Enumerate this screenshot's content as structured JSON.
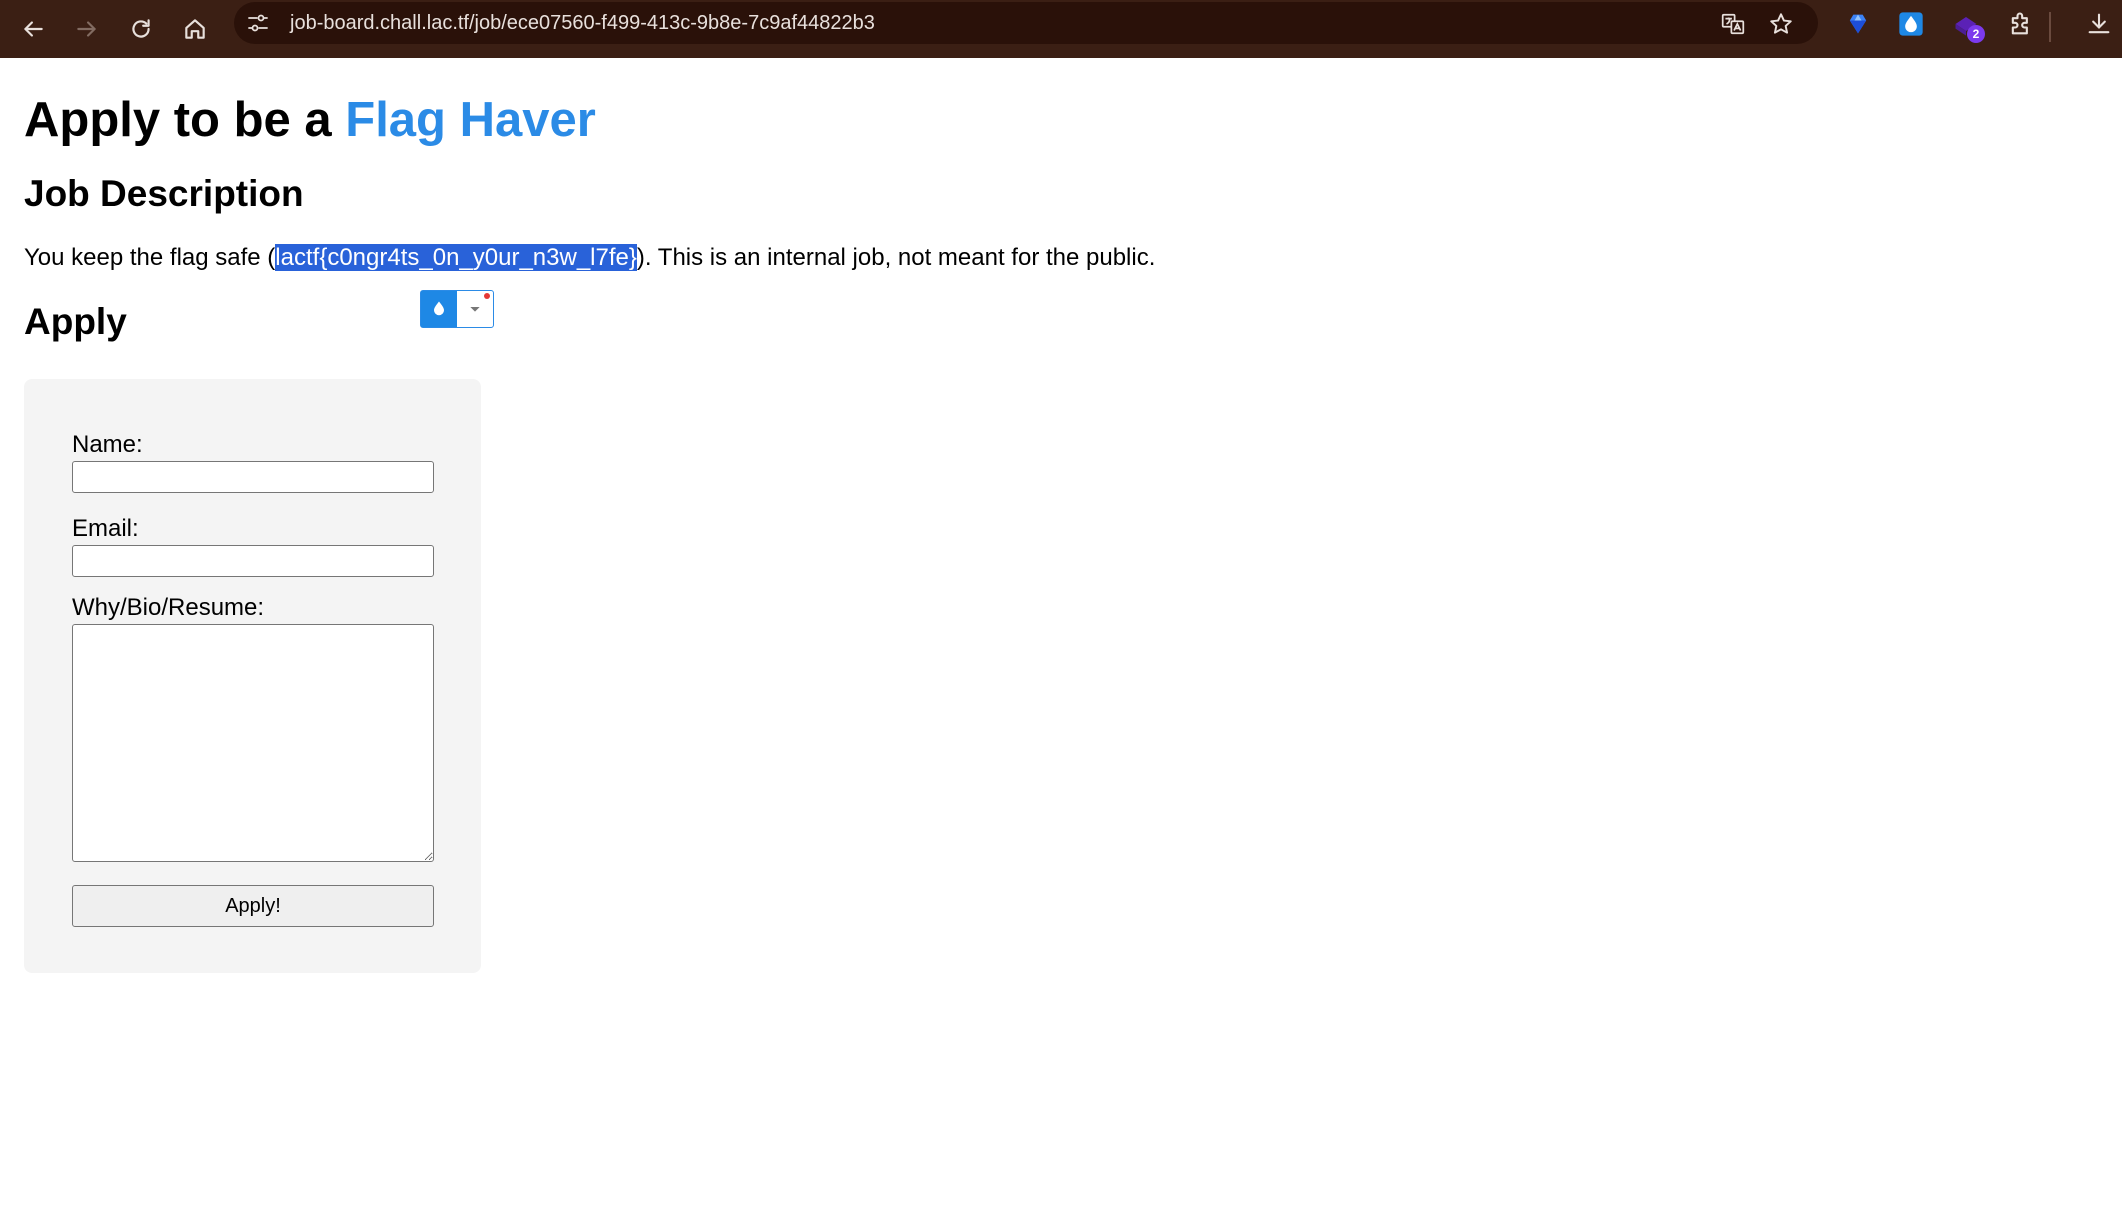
{
  "browser": {
    "url": "job-board.chall.lac.tf/job/ece07560-f499-413c-9b8e-7c9af44822b3",
    "extension_badge": "2",
    "icons": [
      "back-icon",
      "forward-icon",
      "reload-icon",
      "home-icon",
      "site-info-icon",
      "translate-icon",
      "bookmark-star-icon",
      "gem-extension-icon",
      "water-drop-extension-icon",
      "extension-with-badge-icon",
      "extensions-puzzle-icon",
      "download-icon"
    ],
    "colors": {
      "toolbar": "#3b1f14",
      "omnibox": "#2a1109"
    }
  },
  "page": {
    "title_prefix": "Apply to be a ",
    "title_accent": "Flag Haver",
    "accent_color": "#2b8be6",
    "job_description_heading": "Job Description",
    "description_before": "You keep the flag safe (",
    "description_selected": "lactf{c0ngr4ts_0n_y0ur_n3w_l7fe}",
    "description_after": "). This is an internal job, not meant for the public.",
    "selection_color": "#2962d9",
    "apply_heading": "Apply"
  },
  "form": {
    "name_label": "Name:",
    "name_value": "",
    "email_label": "Email:",
    "email_value": "",
    "bio_label": "Why/Bio/Resume:",
    "bio_value": "",
    "submit_label": "Apply!"
  }
}
